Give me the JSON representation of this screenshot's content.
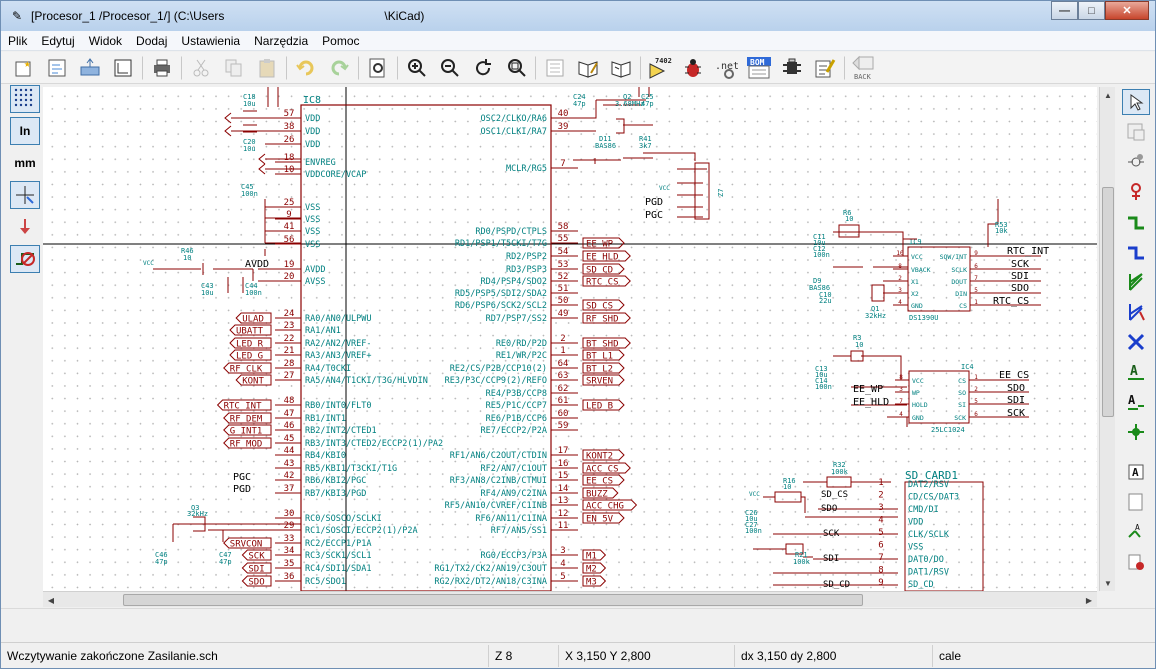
{
  "window": {
    "title_left": "[Procesor_1 /Procesor_1/] (C:\\Users",
    "title_right": "\\KiCad)"
  },
  "menu": [
    "Plik",
    "Edytuj",
    "Widok",
    "Dodaj",
    "Ustawienia",
    "Narzędzia",
    "Pomoc"
  ],
  "toolbar": {
    "icons": [
      "new-sheet-icon",
      "sheet-set-icon",
      "load-icon",
      "page-settings-icon",
      "print-icon",
      "cut-icon",
      "copy-icon",
      "paste-icon",
      "undo-icon",
      "redo-icon",
      "find-icon",
      "zoom-in-icon",
      "zoom-out-icon",
      "redraw-icon",
      "zoom-fit-icon",
      "hierarchy-icon",
      "library-editor-icon",
      "library-browser-icon",
      "annotate-icon",
      "erc-icon",
      "netlist-icon",
      "bom-icon",
      "cvpcb-icon",
      "edit-fields-icon",
      "back-icon"
    ],
    "annotate_label": "7402",
    "netlist_label": ".net",
    "bom_label": "BOM",
    "back_label": "BACK"
  },
  "left_toolbar": {
    "inch_label": "In",
    "mm_label": "mm"
  },
  "schematic": {
    "ic_main_ref": "IC8",
    "ic_main_left_pins": [
      {
        "num": "57",
        "name": "VDD"
      },
      {
        "num": "38",
        "name": "VDD"
      },
      {
        "num": "26",
        "name": "VDD"
      },
      {
        "num": "18",
        "name": "ENVREG"
      },
      {
        "num": "10",
        "name": "VDDCORE/VCAP"
      },
      {
        "num": "25",
        "name": "VSS"
      },
      {
        "num": "9",
        "name": "VSS"
      },
      {
        "num": "41",
        "name": "VSS"
      },
      {
        "num": "56",
        "name": "VSS"
      },
      {
        "num": "19",
        "name": "AVDD"
      },
      {
        "num": "20",
        "name": "AVSS"
      },
      {
        "num": "24",
        "name": "RA0/AN0/ULPWU"
      },
      {
        "num": "23",
        "name": "RA1/AN1"
      },
      {
        "num": "22",
        "name": "RA2/AN2/VREF-"
      },
      {
        "num": "21",
        "name": "RA3/AN3/VREF+"
      },
      {
        "num": "28",
        "name": "RA4/T0CKI"
      },
      {
        "num": "27",
        "name": "RA5/AN4/T1CKI/T3G/HLVDIN"
      },
      {
        "num": "48",
        "name": "RB0/INT0/FLT0"
      },
      {
        "num": "47",
        "name": "RB1/INT1"
      },
      {
        "num": "46",
        "name": "RB2/INT2/CTED1"
      },
      {
        "num": "45",
        "name": "RB3/INT3/CTED2/ECCP2(1)/PA2"
      },
      {
        "num": "44",
        "name": "RB4/KBI0"
      },
      {
        "num": "43",
        "name": "RB5/KBI1/T3CKI/T1G"
      },
      {
        "num": "42",
        "name": "RB6/KBI2/PGC"
      },
      {
        "num": "37",
        "name": "RB7/KBI3/PGD"
      },
      {
        "num": "30",
        "name": "RC0/SOSCO/SCLKI"
      },
      {
        "num": "29",
        "name": "RC1/SOSCI/ECCP2(1)/P2A"
      },
      {
        "num": "33",
        "name": "RC2/ECCP1/P1A"
      },
      {
        "num": "34",
        "name": "RC3/SCK1/SCL1"
      },
      {
        "num": "35",
        "name": "RC4/SDI1/SDA1"
      },
      {
        "num": "36",
        "name": "RC5/SDO1"
      }
    ],
    "ic_main_right_pins": [
      {
        "num": "40",
        "name": "OSC2/CLKO/RA6"
      },
      {
        "num": "39",
        "name": "OSC1/CLKI/RA7"
      },
      {
        "num": "7",
        "name": "MCLR/RG5"
      },
      {
        "num": "58",
        "name": "RD0/PSPD/CTPLS"
      },
      {
        "num": "55",
        "name": "RD1/PSP1/T5CKI/T7G"
      },
      {
        "num": "54",
        "name": "RD2/PSP2"
      },
      {
        "num": "53",
        "name": "RD3/PSP3"
      },
      {
        "num": "52",
        "name": "RD4/PSP4/SDO2"
      },
      {
        "num": "51",
        "name": "RD5/PSP5/SDI2/SDA2"
      },
      {
        "num": "50",
        "name": "RD6/PSP6/SCK2/SCL2"
      },
      {
        "num": "49",
        "name": "RD7/PSP7/SS2"
      },
      {
        "num": "2",
        "name": "RE0/RD/P2D"
      },
      {
        "num": "1",
        "name": "RE1/WR/P2C"
      },
      {
        "num": "64",
        "name": "RE2/CS/P2B/CCP10(2)"
      },
      {
        "num": "63",
        "name": "RE3/P3C/CCP9(2)/REFO"
      },
      {
        "num": "62",
        "name": "RE4/P3B/CCP8"
      },
      {
        "num": "61",
        "name": "RE5/P1C/CCP7"
      },
      {
        "num": "60",
        "name": "RE6/P1B/CCP6"
      },
      {
        "num": "59",
        "name": "RE7/ECCP2/P2A"
      },
      {
        "num": "17",
        "name": "RF1/AN6/C2OUT/CTDIN"
      },
      {
        "num": "16",
        "name": "RF2/AN7/C1OUT"
      },
      {
        "num": "15",
        "name": "RF3/AN8/C2INB/CTMUI"
      },
      {
        "num": "14",
        "name": "RF4/AN9/C2INA"
      },
      {
        "num": "13",
        "name": "RF5/AN10/CVREF/C1INB"
      },
      {
        "num": "12",
        "name": "RF6/AN11/C1INA"
      },
      {
        "num": "11",
        "name": "RF7/AN5/SS1"
      },
      {
        "num": "3",
        "name": "RG0/ECCP3/P3A"
      },
      {
        "num": "4",
        "name": "RG1/TX2/CK2/AN19/C3OUT"
      },
      {
        "num": "5",
        "name": "RG2/RX2/DT2/AN18/C3INA"
      }
    ],
    "left_nets": [
      "ULAD",
      "UBATT",
      "LED_R",
      "LED_G",
      "RF_CLK",
      "KONT",
      "RTC_INT",
      "RF_DEM",
      "G_INT1",
      "RF_MOD",
      "SRVCON",
      "SCK",
      "SDI",
      "SDO"
    ],
    "right_nets": [
      "EE_WP",
      "EE_HLD",
      "SD_CD",
      "RTC_CS",
      "SD_CS",
      "RF_SHD",
      "BT_SHD",
      "BT_L1",
      "BT_L2",
      "SRVEN",
      "LED_B",
      "KONT2",
      "ACC_CS",
      "EE_CS",
      "BUZZ",
      "ACC_CHG",
      "EN_5V",
      "M1",
      "M2",
      "M3"
    ],
    "labels": {
      "avdd": "AVDD",
      "pgc": "PGC",
      "pgd": "PGD",
      "vcc": "VCC",
      "c18": "C18",
      "c18v": "10u",
      "c20": "C20",
      "c20v": "10u",
      "c45": "C45",
      "c45v": "100n",
      "c43": "C43",
      "c43v": "10u",
      "c44": "C44",
      "c44v": "100n",
      "r46": "R46",
      "r46v": "10",
      "c24": "C24",
      "c24v": "47p",
      "q2": "Q2",
      "q2v": "3.68MHz",
      "c25": "C25",
      "c25v": "47p",
      "d11": "D11",
      "d11v": "BAS86",
      "r41": "R41",
      "r41v": "3k7",
      "z7": "Z7",
      "q3": "Q3",
      "q3v": "32kHz",
      "c46": "C46",
      "c46v": "47p",
      "c47": "C47",
      "c47v": "47p",
      "r6": "R6",
      "r6v": "10",
      "ic9": "IC9",
      "ic9name": "DS1390U",
      "r53": "R53",
      "r53v": "10k",
      "c11": "C11",
      "c11v": "10u",
      "c12": "C12",
      "c12v": "100n",
      "d9": "D9",
      "d9v": "BAS86",
      "c10": "C10",
      "c10v": "22u",
      "q1": "Q1",
      "q1v": "32kHz",
      "ic9_left": [
        "VCC",
        "VBACK",
        "X1",
        "X2",
        "GND"
      ],
      "ic9_right": [
        "SQW/INT",
        "SCLK",
        "DOUT",
        "DIN",
        "CS"
      ],
      "ic9_left_nums": [
        "10",
        "8",
        "2",
        "3",
        "4"
      ],
      "ic9_right_nums": [
        "9",
        "6",
        "7",
        "5",
        "1"
      ],
      "rtc_int": "RTC_INT",
      "sck": "SCK",
      "sdi": "SDI",
      "sdo": "SDO",
      "rtc_cs": "RTC_CS",
      "r3": "R3",
      "r3v": "10",
      "c13": "C13",
      "c13v": "10u",
      "c14": "C14",
      "c14v": "100n",
      "ic4": "IC4",
      "ic4name": "25LC1024",
      "ic4_left": [
        "VCC",
        "WP",
        "HOLD",
        "GND"
      ],
      "ic4_right": [
        "CS",
        "SO",
        "SI",
        "SCK"
      ],
      "ic4_left_nums": [
        "8",
        "3",
        "7",
        "4"
      ],
      "ic4_right_nums": [
        "1",
        "2",
        "5",
        "6"
      ],
      "ee_cs": "EE_CS",
      "ee_wp": "EE_WP",
      "ee_hld": "EE_HLD",
      "sd_card": "SD_CARD1",
      "sd_pins": [
        "DAT2/RSV",
        "CD/CS/DAT3",
        "CMD/DI",
        "VDD",
        "CLK/SCLK",
        "VSS",
        "DAT0/DO",
        "DAT1/RSV",
        "SD_CD"
      ],
      "r32": "R32",
      "r32v": "100k",
      "r16": "R16",
      "r16v": "10",
      "c26": "C26",
      "c26v": "10u",
      "c27": "C27",
      "c27v": "100n",
      "r21": "R21",
      "r21v": "100k",
      "sd_cs": "SD_CS",
      "sd_cd_net": "SD_CD"
    }
  },
  "status": {
    "message": "Wczytywanie zakończone Zasilanie.sch",
    "zoom": "Z 8",
    "xy": "X 3,150  Y 2,800",
    "dxdy": "dx 3,150  dy 2,800",
    "units": "cale"
  }
}
